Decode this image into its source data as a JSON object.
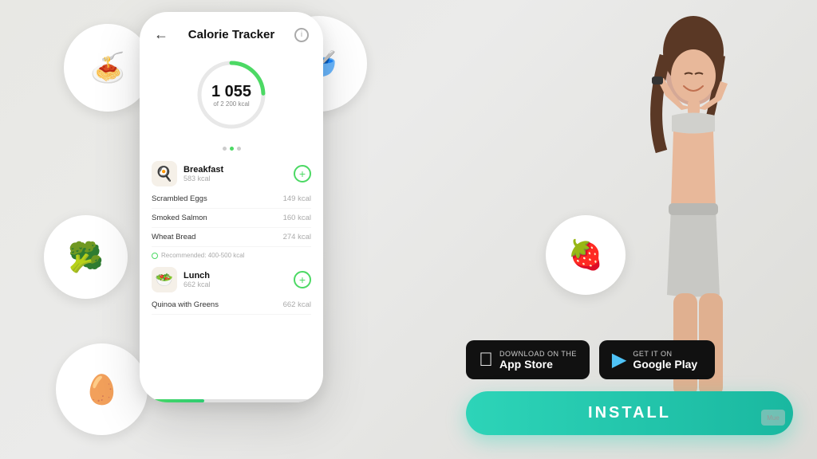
{
  "app": {
    "background_color": "#ebebea"
  },
  "phone": {
    "title": "Calorie Tracker",
    "back_label": "←",
    "calorie_main": "1 055",
    "calorie_goal": "of 2 200 kcal",
    "meals": [
      {
        "name": "Breakfast",
        "kcal": "583 kcal",
        "items": [
          {
            "name": "Scrambled Eggs",
            "kcal": "149 kcal"
          },
          {
            "name": "Smoked Salmon",
            "kcal": "160 kcal"
          },
          {
            "name": "Wheat Bread",
            "kcal": "274 kcal"
          }
        ],
        "recommendation": "Recommended: 400-500 kcal",
        "icon": "🍳"
      },
      {
        "name": "Lunch",
        "kcal": "662 kcal",
        "items": [
          {
            "name": "Quinoa with Greens",
            "kcal": "662 kcal"
          }
        ],
        "icon": "🥗"
      }
    ]
  },
  "store_buttons": {
    "appstore": {
      "small": "Download on the",
      "big": "App Store",
      "icon": ""
    },
    "googleplay": {
      "small": "GET IT ON",
      "big": "Google Play",
      "icon": "▶"
    }
  },
  "install_button": {
    "label": "INSTALL"
  },
  "food_plates": [
    {
      "emoji": "🍝",
      "position": "top-left"
    },
    {
      "emoji": "🥣",
      "position": "top-right"
    },
    {
      "emoji": "🥦",
      "position": "middle-left"
    },
    {
      "emoji": "🍓",
      "position": "middle-right"
    },
    {
      "emoji": "🥚",
      "position": "bottom-left"
    }
  ],
  "logo_label": "Mue"
}
